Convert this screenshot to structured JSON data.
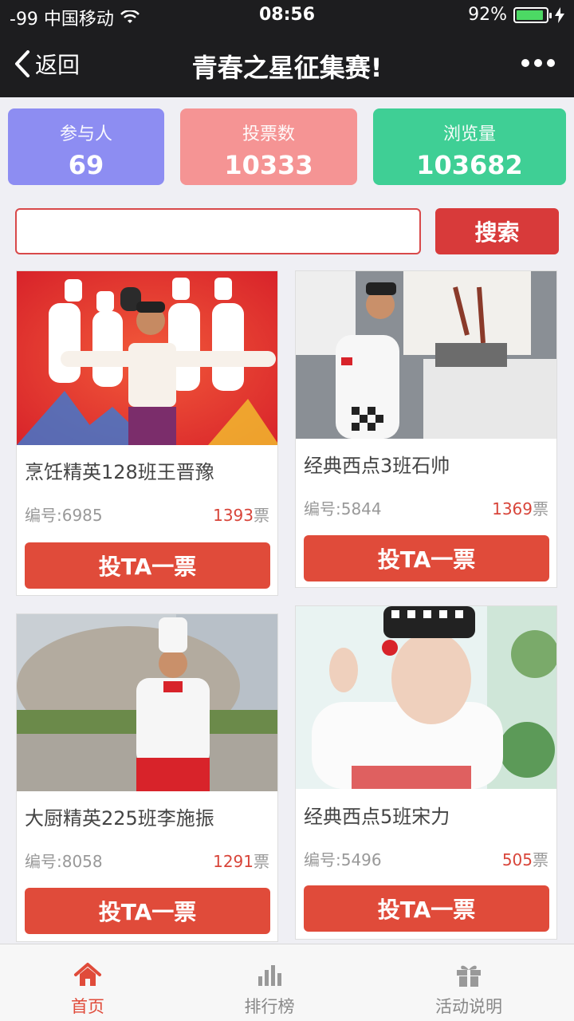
{
  "status_bar": {
    "carrier": "-99 中国移动",
    "time": "08:56",
    "battery": "92%",
    "battery_level": 0.92
  },
  "nav": {
    "back_label": "返回",
    "title": "青春之星征集赛!"
  },
  "stats": [
    {
      "label": "参与人",
      "value": "69",
      "color": "#8d8df2"
    },
    {
      "label": "投票数",
      "value": "10333",
      "color": "#f59494"
    },
    {
      "label": "浏览量",
      "value": "103682",
      "color": "#3fcf95"
    }
  ],
  "search": {
    "placeholder": "",
    "button_label": "搜索"
  },
  "cards": [
    {
      "name": "烹饪精英128班王晋豫",
      "number_label": "编号:6985",
      "votes": "1393",
      "votes_unit": "票",
      "vote_button": "投TA一票"
    },
    {
      "name": "经典西点3班石帅",
      "number_label": "编号:5844",
      "votes": "1369",
      "votes_unit": "票",
      "vote_button": "投TA一票"
    },
    {
      "name": "大厨精英225班李施振",
      "number_label": "编号:8058",
      "votes": "1291",
      "votes_unit": "票",
      "vote_button": "投TA一票"
    },
    {
      "name": "经典西点5班宋力",
      "number_label": "编号:5496",
      "votes": "505",
      "votes_unit": "票",
      "vote_button": "投TA一票"
    }
  ],
  "tabbar": [
    {
      "label": "首页",
      "icon": "home-icon",
      "active": true
    },
    {
      "label": "排行榜",
      "icon": "ranking-icon",
      "active": false
    },
    {
      "label": "活动说明",
      "icon": "gift-icon",
      "active": false
    }
  ],
  "colors": {
    "accent": "#e04b3a",
    "nav_bg": "#1d1d1f"
  }
}
